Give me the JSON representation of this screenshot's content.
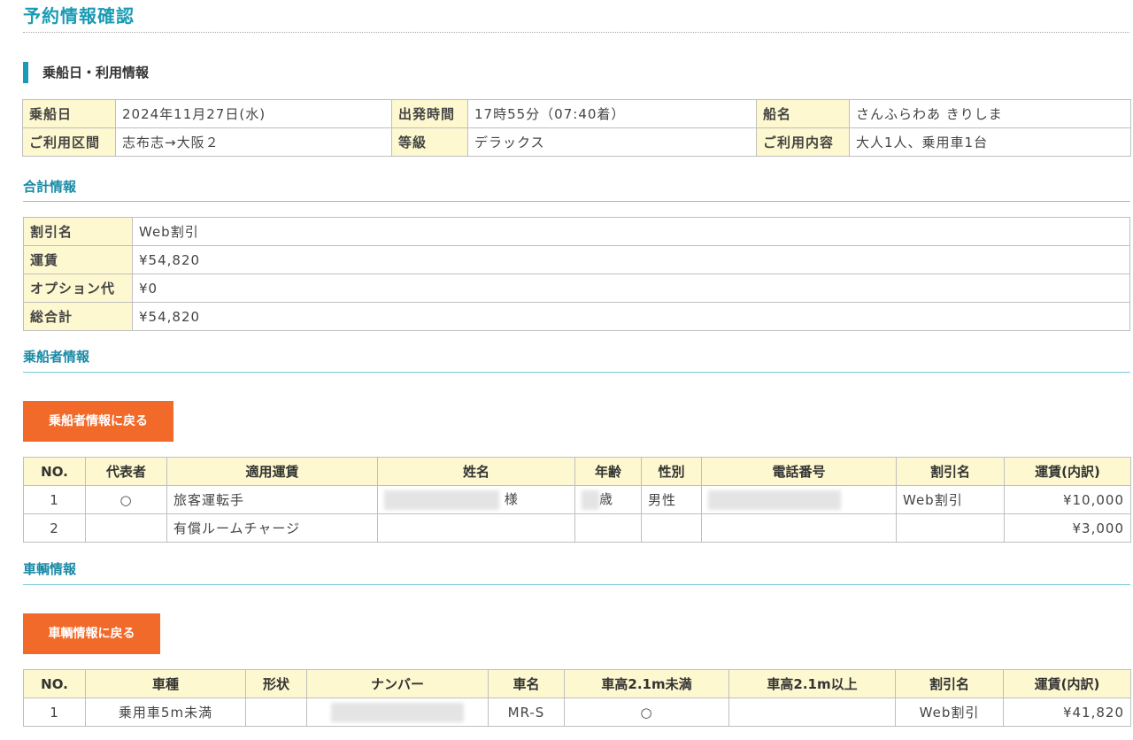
{
  "page": {
    "title": "予約情報確認"
  },
  "boarding": {
    "heading": "乗船日・利用情報",
    "row1": {
      "date_label": "乗船日",
      "date": "2024年11月27日(水)",
      "dep_label": "出発時間",
      "dep": "17時55分（07:40着）",
      "ship_label": "船名",
      "ship": "さんふらわあ きりしま"
    },
    "row2": {
      "route_label": "ご利用区間",
      "route": "志布志→大阪２",
      "class_label": "等級",
      "class": "デラックス",
      "usage_label": "ご利用内容",
      "usage": "大人1人、乗用車1台"
    }
  },
  "totals": {
    "heading": "合計情報",
    "rows": [
      {
        "label": "割引名",
        "value": "Web割引"
      },
      {
        "label": "運賃",
        "value": "¥54,820"
      },
      {
        "label": "オプション代",
        "value": "¥0"
      },
      {
        "label": "総合計",
        "value": "¥54,820"
      }
    ]
  },
  "passengers": {
    "heading": "乗船者情報",
    "back_button": "乗船者情報に戻る",
    "headers": [
      "NO.",
      "代表者",
      "適用運賃",
      "姓名",
      "年齢",
      "性別",
      "電話番号",
      "割引名",
      "運賃(内訳)"
    ],
    "rows": [
      {
        "no": "1",
        "rep": "○",
        "fare_type": "旅客運転手",
        "name_suffix": "様",
        "age_suffix": "歳",
        "gender": "男性",
        "discount": "Web割引",
        "fare": "¥10,000"
      },
      {
        "no": "2",
        "rep": "",
        "fare_type": "有償ルームチャージ",
        "name_suffix": "",
        "age_suffix": "",
        "gender": "",
        "discount": "",
        "fare": "¥3,000"
      }
    ]
  },
  "vehicles": {
    "heading": "車輌情報",
    "back_button": "車輌情報に戻る",
    "headers": [
      "NO.",
      "車種",
      "形状",
      "ナンバー",
      "車名",
      "車高2.1m未満",
      "車高2.1m以上",
      "割引名",
      "運賃(内訳)"
    ],
    "rows": [
      {
        "no": "1",
        "type": "乗用車5m未満",
        "shape": "",
        "car_name": "MR-S",
        "under": "○",
        "over": "",
        "discount": "Web割引",
        "fare": "¥41,820"
      }
    ]
  }
}
